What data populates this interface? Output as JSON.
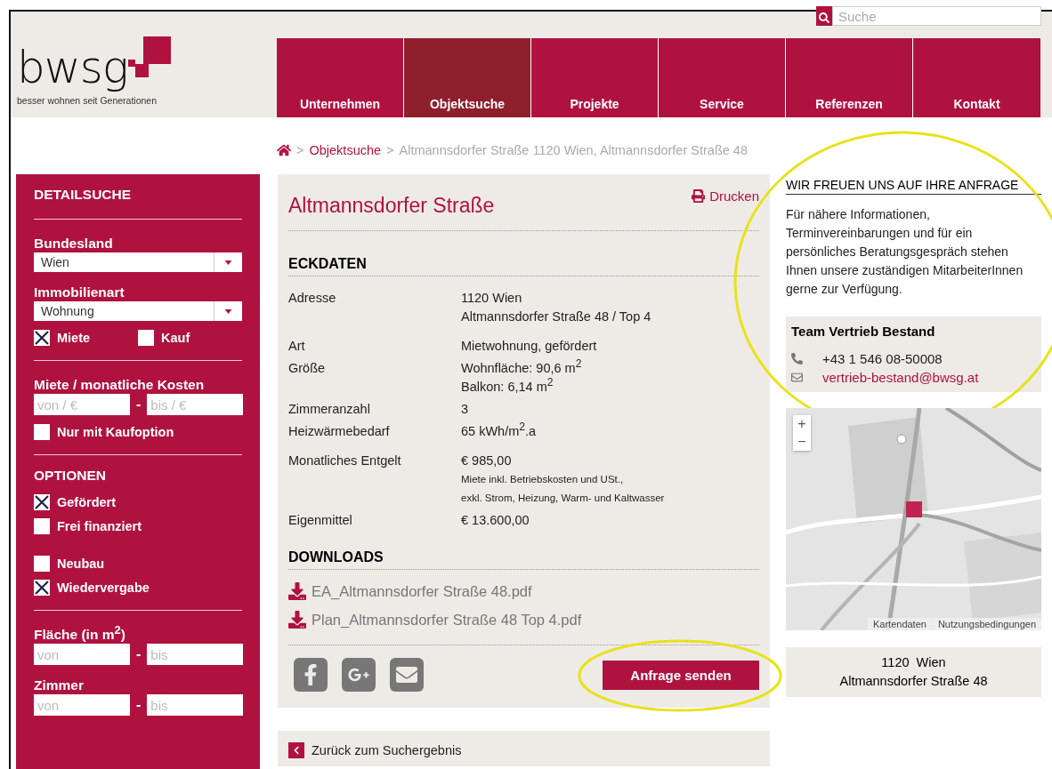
{
  "header": {
    "logo_text": "bwsg",
    "tagline": "besser wohnen seit Generationen",
    "search": {
      "placeholder": "Suche"
    }
  },
  "nav": [
    {
      "label": "Unternehmen",
      "selected": false
    },
    {
      "label": "Objektsuche",
      "selected": true
    },
    {
      "label": "Projekte",
      "selected": false
    },
    {
      "label": "Service",
      "selected": false
    },
    {
      "label": "Referenzen",
      "selected": false
    },
    {
      "label": "Kontakt",
      "selected": false
    }
  ],
  "breadcrumb": {
    "separator": ">",
    "items": [
      {
        "label": "Objektsuche",
        "link": true
      },
      {
        "label": "Altmannsdorfer Straße 1120 Wien, Altmannsdorfer Straße 48",
        "link": false
      }
    ]
  },
  "sidebar": {
    "groups": [
      [
        {
          "kind": "heading",
          "text": "DETAILSUCHE"
        }
      ],
      [
        {
          "kind": "select",
          "label": "Bundesland",
          "value": "Wien"
        },
        {
          "kind": "select",
          "label": "Immobilienart",
          "value": "Wohnung"
        },
        {
          "kind": "checkpair",
          "items": [
            {
              "label": "Miete",
              "checked": true
            },
            {
              "label": "Kauf",
              "checked": false
            }
          ]
        }
      ],
      [
        {
          "kind": "range",
          "label": "Miete / monatliche Kosten",
          "from": {
            "placeholder": "von / €"
          },
          "to": {
            "placeholder": "bis / €"
          },
          "dash": "-"
        },
        {
          "kind": "checklist",
          "items": [
            {
              "label": "Nur mit Kaufoption",
              "checked": false
            }
          ]
        }
      ],
      [
        {
          "kind": "heading",
          "text": "OPTIONEN"
        },
        {
          "kind": "checklist",
          "items": [
            {
              "label": "Gefördert",
              "checked": true
            },
            {
              "label": "Frei finanziert",
              "checked": false
            }
          ]
        },
        {
          "kind": "checklist",
          "items": [
            {
              "label": "Neubau",
              "checked": false
            },
            {
              "label": "Wiedervergabe",
              "checked": true
            }
          ]
        }
      ],
      [
        {
          "kind": "range",
          "label": "Fläche (in m$^{2}$)",
          "from": {
            "placeholder": "von"
          },
          "to": {
            "placeholder": "bis"
          },
          "dash": "-"
        },
        {
          "kind": "range",
          "label": "Zimmer",
          "from": {
            "placeholder": "von"
          },
          "to": {
            "placeholder": "bis"
          },
          "dash": "-"
        }
      ]
    ]
  },
  "listing": {
    "title": "Altmannsdorfer Straße",
    "print": "Drucken",
    "facts_heading": "ECKDATEN",
    "facts": [
      {
        "label": "Adresse",
        "values": [
          "1120 Wien",
          "Altmannsdorfer Straße 48 / Top 4"
        ]
      },
      {
        "label": "Art",
        "values": [
          "Mietwohnung, gefördert"
        ]
      },
      {
        "label": "Größe",
        "values": [
          "Wohnfläche: 90,6 m$^{2}$",
          "Balkon: 6,14 m$^{2}$"
        ]
      },
      {
        "label": "Zimmeranzahl",
        "values": [
          "3"
        ]
      },
      {
        "label": "Heizwärmebedarf",
        "values": [
          "65 kWh/m$^{2}$.a"
        ]
      },
      {
        "label": "Monatliches Entgelt",
        "values": [
          "€ 985,00"
        ],
        "notes": [
          "Miete inkl. Betriebskosten und USt.,",
          "exkl. Strom, Heizung, Warm- und Kaltwasser"
        ]
      },
      {
        "label": "Eigenmittel",
        "values": [
          "€ 13.600,00"
        ]
      }
    ],
    "downloads_heading": "DOWNLOADS",
    "downloads": [
      "EA_Altmannsdorfer Straße 48.pdf",
      "Plan_Altmannsdorfer Straße 48 Top 4.pdf"
    ],
    "share": [
      {
        "kind": "facebook"
      },
      {
        "kind": "googleplus"
      },
      {
        "kind": "email"
      }
    ],
    "send_button": {
      "label": "Anfrage senden",
      "highlighted": true
    },
    "back": "Zurück zum Suchergebnis"
  },
  "contact": {
    "highlighted": true,
    "heading": "WIR FREUEN UNS AUF IHRE ANFRAGE",
    "text": "Für nähere Informationen, Terminvereinbarungen und für ein persönliches Beratungsgespräch stehen Ihnen unsere zuständigen MitarbeiterInnen gerne zur Verfügung.",
    "team": "Team Vertrieb Bestand",
    "phone": "+43 1 546 08-50008",
    "email": "vertrieb-bestand@bwsg.at"
  },
  "map": {
    "kind": "picture",
    "zoom_in": "+",
    "zoom_out": "−",
    "attribution": [
      "Kartendaten",
      "Nutzungsbedingungen"
    ]
  },
  "address_box": [
    "1120  Wien",
    "Altmannsdorfer Straße 48"
  ]
}
